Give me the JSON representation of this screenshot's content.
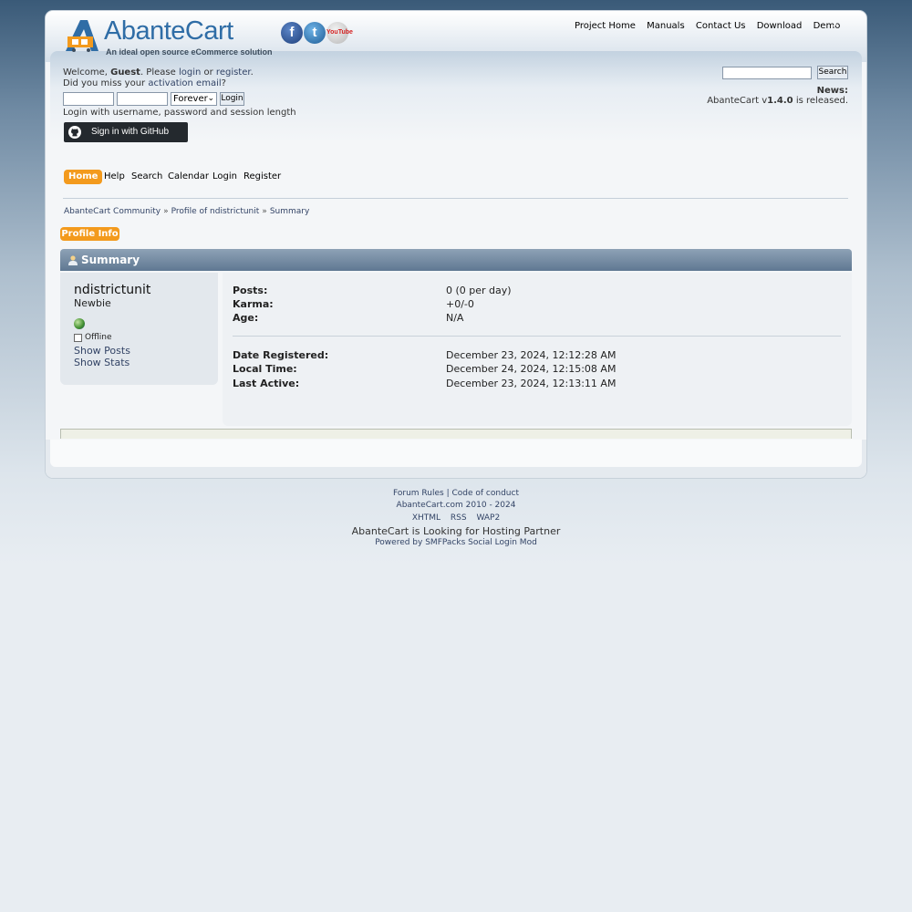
{
  "header": {
    "logo_name": "AbanteCart",
    "logo_tagline": "An ideal open source eCommerce solution",
    "social": {
      "facebook": "f",
      "twitter": "t",
      "youtube": "YouTube"
    },
    "top_links": [
      "Project Home",
      "Manuals",
      "Contact Us",
      "Download",
      "Demo"
    ],
    "collapse_icon": "chevron-up-icon"
  },
  "user_area": {
    "welcome_prefix": "Welcome, ",
    "guest": "Guest",
    "please": ". Please ",
    "login_link": "login",
    "or": " or ",
    "register_link": "register",
    "period": ".",
    "activation_prefix": "Did you miss your ",
    "activation_link": "activation email",
    "activation_suffix": "?",
    "session_length": "Forever",
    "login_button": "Login",
    "login_hint": "Login with username, password and session length",
    "github_button": "Sign in with GitHub"
  },
  "search": {
    "button": "Search"
  },
  "news": {
    "label": "News:",
    "prefix": "AbanteCart v",
    "version": "1.4.0",
    "suffix": " is released."
  },
  "menu": {
    "items": [
      "Home",
      "Help",
      "Search",
      "Calendar",
      "Login",
      "Register"
    ],
    "active": "Home"
  },
  "breadcrumb": {
    "items": [
      "AbanteCart Community",
      "Profile of ndistrictunit",
      "Summary"
    ],
    "separator": "»"
  },
  "profile_tab": "Profile Info",
  "summary": {
    "title": "Summary",
    "username": "ndistrictunit",
    "member_title": "Newbie",
    "status": "Offline",
    "show_posts": "Show Posts",
    "show_stats": "Show Stats",
    "stats": [
      {
        "label": "Posts:",
        "value": "0 (0 per day)"
      },
      {
        "label": "Karma:",
        "value": "+0/-0"
      },
      {
        "label": "Age:",
        "value": "N/A"
      }
    ],
    "dates": [
      {
        "label": "Date Registered:",
        "value": "December 23, 2024, 12:12:28 AM"
      },
      {
        "label": "Local Time:",
        "value": "December 24, 2024, 12:15:08 AM"
      },
      {
        "label": "Last Active:",
        "value": "December 23, 2024, 12:13:11 AM"
      }
    ]
  },
  "footer": {
    "forum_rules": "Forum Rules",
    "separator": "|",
    "code_of_conduct": "Code of conduct",
    "copyright": "AbanteCart.com 2010 - 2024",
    "links": [
      "XHTML",
      "RSS",
      "WAP2"
    ],
    "hosting": "AbanteCart is Looking for Hosting Partner",
    "powered": "Powered by SMFPacks Social Login Mod"
  },
  "colors": {
    "accent": "#f39a1d",
    "link": "#334466",
    "header_bar": "#5f7892",
    "github": "#24292e"
  }
}
